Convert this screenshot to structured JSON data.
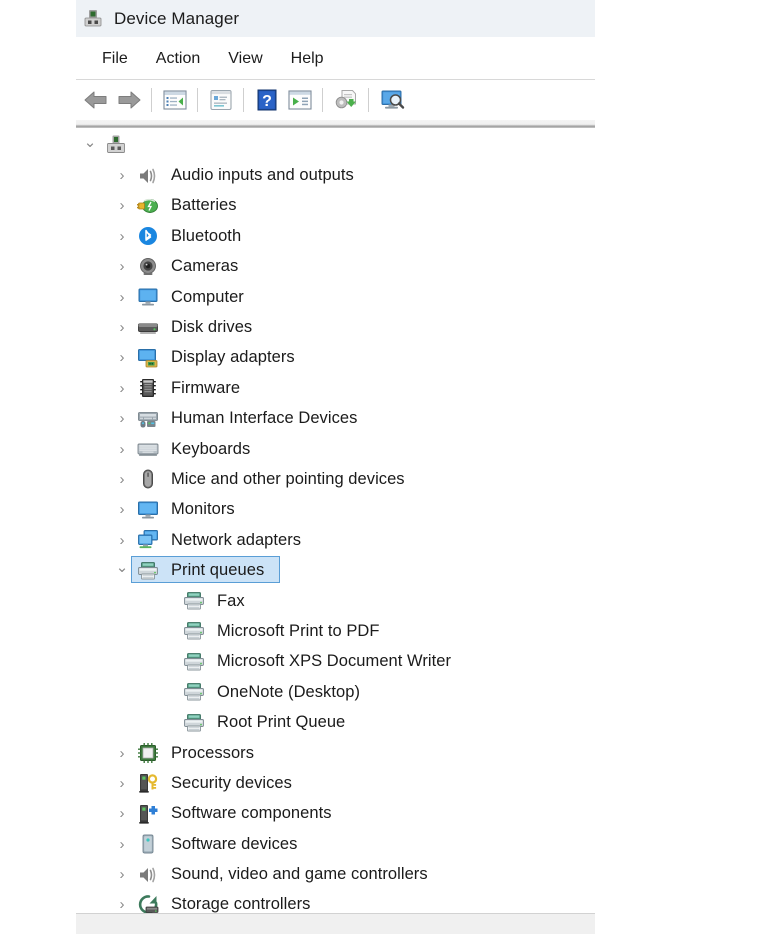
{
  "window": {
    "title": "Device Manager",
    "title_icon": "device-manager-icon"
  },
  "menu": {
    "items": [
      {
        "label": "File",
        "name": "menu-file"
      },
      {
        "label": "Action",
        "name": "menu-action"
      },
      {
        "label": "View",
        "name": "menu-view"
      },
      {
        "label": "Help",
        "name": "menu-help"
      }
    ]
  },
  "toolbar": {
    "buttons": [
      {
        "name": "back-button",
        "icon": "back-arrow-icon"
      },
      {
        "name": "forward-button",
        "icon": "forward-arrow-icon"
      },
      {
        "name": "show-hide-tree-button",
        "icon": "console-tree-icon"
      },
      {
        "name": "properties-button",
        "icon": "properties-icon"
      },
      {
        "name": "help-button",
        "icon": "help-question-icon"
      },
      {
        "name": "update-driver-button",
        "icon": "update-driver-icon"
      },
      {
        "name": "scan-hardware-button",
        "icon": "scan-hardware-icon"
      },
      {
        "name": "display-resources-button",
        "icon": "monitor-search-icon"
      }
    ]
  },
  "tree": {
    "root": {
      "label": "",
      "icon": "computer-root-icon",
      "expanded": true
    },
    "nodes": [
      {
        "label": "Audio inputs and outputs",
        "icon": "speaker-icon",
        "state": "collapsed",
        "level": 1
      },
      {
        "label": "Batteries",
        "icon": "battery-icon",
        "state": "collapsed",
        "level": 1
      },
      {
        "label": "Bluetooth",
        "icon": "bluetooth-icon",
        "state": "collapsed",
        "level": 1
      },
      {
        "label": "Cameras",
        "icon": "camera-icon",
        "state": "collapsed",
        "level": 1
      },
      {
        "label": "Computer",
        "icon": "computer-icon",
        "state": "collapsed",
        "level": 1
      },
      {
        "label": "Disk drives",
        "icon": "disk-drive-icon",
        "state": "collapsed",
        "level": 1
      },
      {
        "label": "Display adapters",
        "icon": "display-adapter-icon",
        "state": "collapsed",
        "level": 1
      },
      {
        "label": "Firmware",
        "icon": "firmware-icon",
        "state": "collapsed",
        "level": 1
      },
      {
        "label": "Human Interface Devices",
        "icon": "hid-icon",
        "state": "collapsed",
        "level": 1
      },
      {
        "label": "Keyboards",
        "icon": "keyboard-icon",
        "state": "collapsed",
        "level": 1
      },
      {
        "label": "Mice and other pointing devices",
        "icon": "mouse-icon",
        "state": "collapsed",
        "level": 1
      },
      {
        "label": "Monitors",
        "icon": "monitor-icon",
        "state": "collapsed",
        "level": 1
      },
      {
        "label": "Network adapters",
        "icon": "network-adapter-icon",
        "state": "collapsed",
        "level": 1
      },
      {
        "label": "Print queues",
        "icon": "printer-icon",
        "state": "expanded",
        "level": 1,
        "selected": true
      },
      {
        "label": "Fax",
        "icon": "printer-icon",
        "state": "none",
        "level": 2
      },
      {
        "label": "Microsoft Print to PDF",
        "icon": "printer-icon",
        "state": "none",
        "level": 2
      },
      {
        "label": "Microsoft XPS Document Writer",
        "icon": "printer-icon",
        "state": "none",
        "level": 2
      },
      {
        "label": "OneNote (Desktop)",
        "icon": "printer-icon",
        "state": "none",
        "level": 2
      },
      {
        "label": "Root Print Queue",
        "icon": "printer-icon",
        "state": "none",
        "level": 2
      },
      {
        "label": "Processors",
        "icon": "processor-icon",
        "state": "collapsed",
        "level": 1
      },
      {
        "label": "Security devices",
        "icon": "security-device-icon",
        "state": "collapsed",
        "level": 1
      },
      {
        "label": "Software components",
        "icon": "software-component-icon",
        "state": "collapsed",
        "level": 1
      },
      {
        "label": "Software devices",
        "icon": "software-device-icon",
        "state": "collapsed",
        "level": 1
      },
      {
        "label": "Sound, video and game controllers",
        "icon": "speaker-icon",
        "state": "collapsed",
        "level": 1
      },
      {
        "label": "Storage controllers",
        "icon": "storage-controller-icon",
        "state": "collapsed",
        "level": 1
      }
    ]
  },
  "statusbar": {
    "text": ""
  },
  "colors": {
    "titlebar_bg": "#eef2f6",
    "selection_fill": "#cce3f7",
    "selection_border": "#5a9ed6",
    "text": "#1b1b1b",
    "chevron": "#8a8a8a",
    "statusbar_bg": "#f0f0f0"
  }
}
